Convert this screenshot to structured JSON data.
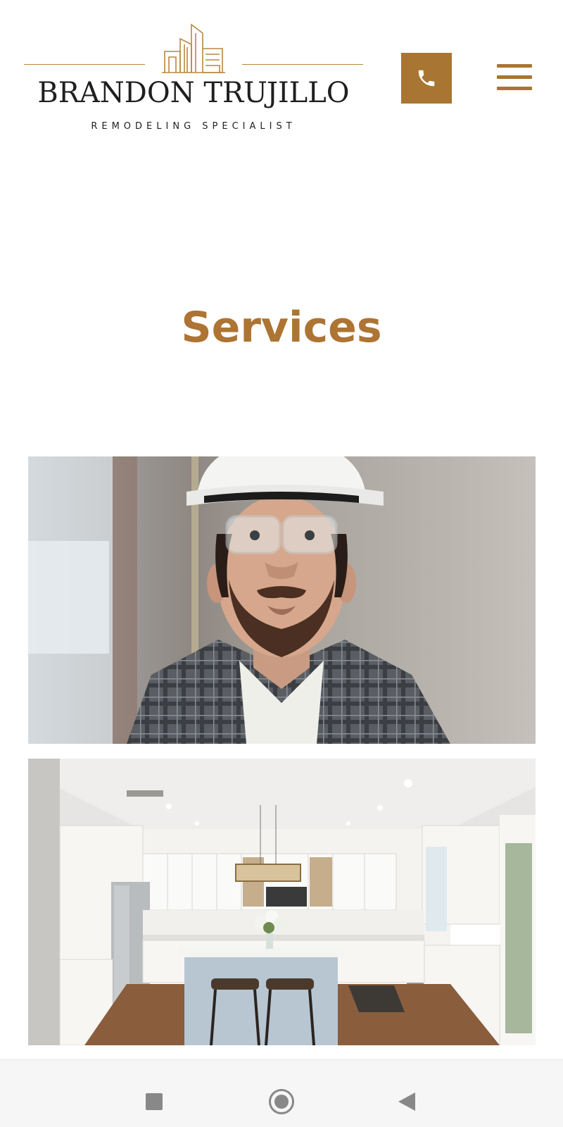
{
  "brand": {
    "name": "BRANDON TRUJILLO",
    "tagline": "REMODELING SPECIALIST",
    "accent_color": "#a87532",
    "logo_icon": "building-outline-icon"
  },
  "header": {
    "phone_icon": "phone-icon",
    "menu_icon": "hamburger-menu-icon"
  },
  "page": {
    "title": "Services"
  },
  "images": [
    {
      "name": "contractor-portrait-photo",
      "subject": "worker with hard hat"
    },
    {
      "name": "kitchen-remodel-photo",
      "subject": "white kitchen with island"
    }
  ],
  "system_nav": {
    "recents_icon": "recents-square-icon",
    "home_icon": "home-circle-icon",
    "back_icon": "back-triangle-icon"
  }
}
